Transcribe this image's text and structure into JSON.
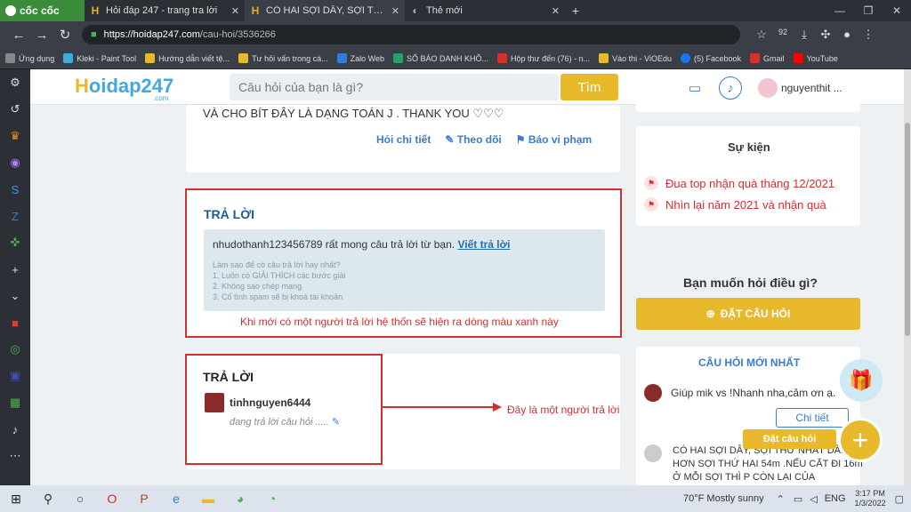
{
  "browser": {
    "brand": "cốc cốc",
    "tabs": [
      {
        "label": "Hỏi đáp 247 - trang tra lời",
        "favicon": "H"
      },
      {
        "label": "CÓ HAI SỢI DÂY, SỢI THỨ N...",
        "favicon": "H"
      },
      {
        "label": "Thẻ mới",
        "favicon": "◐"
      }
    ],
    "url_host": "https://hoidap247.com",
    "url_path": "/cau-hoi/3536266",
    "badge": "92",
    "bookmarks": [
      {
        "label": "Ứng dụng",
        "color": "#888888"
      },
      {
        "label": "Kleki - Paint Tool",
        "color": "#3fa9e0"
      },
      {
        "label": "Hướng dẫn viết tệ...",
        "color": "#e8b92a"
      },
      {
        "label": "Tư hỏi vấn trong cá...",
        "color": "#e8b92a"
      },
      {
        "label": "Zalo Web",
        "color": "#2f7de1"
      },
      {
        "label": "SỔ BÁO DANH KHÔ...",
        "color": "#21a366"
      },
      {
        "label": "Hộp thư đến (76) - n...",
        "color": "#d93025"
      },
      {
        "label": "Vào thi - ViOEdu",
        "color": "#e8b92a"
      },
      {
        "label": "(5) Facebook",
        "color": "#1877f2"
      },
      {
        "label": "Gmail",
        "color": "#d93025"
      },
      {
        "label": "YouTube",
        "color": "#ff0000"
      }
    ]
  },
  "site": {
    "logo_main": "oidap247",
    "logo_h": "H",
    "logo_domain": ".com",
    "search_placeholder": "Câu hỏi của bạn là gì?",
    "search_button": "Tìm",
    "username": "nguyenthit ...",
    "question_text": "VÀ CHO BÍT ĐÂY LÀ DẠNG TOÁN J .    THANK YOU ♡♡♡",
    "question_links": [
      "Hỏi chi tiết",
      "Theo dõi",
      "Báo vi phạm"
    ]
  },
  "answer1": {
    "title": "TRẢ LỜI",
    "notice_text": "nhudothanh123456789 rất mong câu trả lời từ bạn.",
    "notice_link": "Viết trả lời",
    "tips": [
      "Làm sao để có câu trả lời hay nhất?",
      "1. Luôn có GIẢI THÍCH các bước giải",
      "2. Không sao chép mạng",
      "3. Cố tình spam sẽ bị khoá tài khoản"
    ],
    "annotation": "Khi mới có một người trả lời hệ thốn sẽ hiện ra dòng màu xanh này"
  },
  "answer2": {
    "title": "TRẢ LỜI",
    "username": "tinhnguyen6444",
    "status": "đang trả lời câu hỏi .....",
    "annotation": "Đây là một người trả lời"
  },
  "sidebar": {
    "events_title": "Sự kiện",
    "events": [
      "Đua top nhận quà tháng 12/2021",
      "Nhìn lại năm 2021 và nhận quà"
    ],
    "ask_title": "Bạn muốn hỏi điều gì?",
    "ask_button": "ĐẶT CÂU HỎI",
    "newq_title": "CÂU HỎI MỚI NHẤT",
    "newq1": "Giúp mik vs !Nhanh nha,cảm ơn ạ.",
    "detail_button": "Chi tiết",
    "newq2": "CÓ HAI SỢI DÂY, SỢI THỨ NHẤT DÀI HƠN SỢI THỨ HAI 54m .NẾU CẮT ĐI 16m Ở MỖI SỢI THÌ P CÒN LẠI CỦA",
    "fab_label": "Đặt câu hỏi"
  },
  "taskbar": {
    "weather": "70°F  Mostly sunny",
    "lang": "ENG",
    "time": "3:17 PM",
    "date": "1/3/2022"
  },
  "colors": {
    "accent": "#e8b92a",
    "link": "#3a7bd5",
    "annotation": "#d32f2f"
  }
}
